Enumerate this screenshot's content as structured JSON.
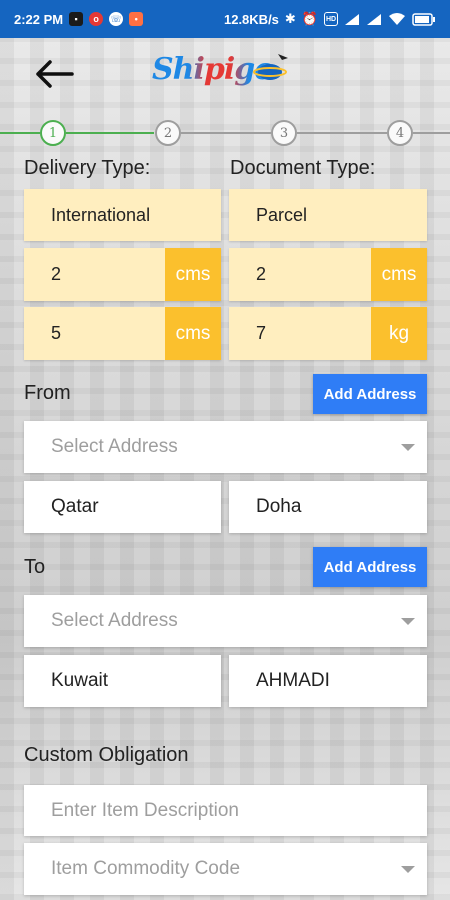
{
  "status_bar": {
    "time": "2:22 PM",
    "network_speed": "12.8KB/s",
    "left_icons": [
      "sim-icon",
      "vodafone-icon",
      "whatsapp-icon",
      "notification-icon"
    ],
    "right_icons": [
      "bluetooth-icon",
      "alarm-icon",
      "volte-icon",
      "signal-icon",
      "signal-icon",
      "wifi-icon",
      "battery-icon"
    ],
    "bar_color": "#1565c0"
  },
  "header": {
    "back_icon": "arrow-left-icon",
    "logo_text": "Shipigo"
  },
  "stepper": {
    "steps": [
      "1",
      "2",
      "3",
      "4"
    ],
    "active_step": "1",
    "active_color": "#4caf50"
  },
  "delivery": {
    "delivery_type_label": "Delivery Type:",
    "document_type_label": "Document Type:",
    "delivery_type_value": "International",
    "document_type_value": "Parcel",
    "dim1_value": "2",
    "dim1_unit": "cms",
    "dim2_value": "2",
    "dim2_unit": "cms",
    "dim3_value": "5",
    "dim3_unit": "cms",
    "weight_value": "7",
    "weight_unit": "kg"
  },
  "from": {
    "label": "From",
    "add_button": "Add Address",
    "select_placeholder": "Select Address",
    "country": "Qatar",
    "city": "Doha"
  },
  "to": {
    "label": "To",
    "add_button": "Add Address",
    "select_placeholder": "Select Address",
    "country": "Kuwait",
    "city": "AHMADI"
  },
  "custom": {
    "label": "Custom Obligation",
    "item_description_placeholder": "Enter Item Description",
    "commodity_code_placeholder": "Item Commodity Code"
  },
  "colors": {
    "field_bg": "#ffeebf",
    "unit_bg": "#fbc02d",
    "button_bg": "#2f7df6"
  }
}
